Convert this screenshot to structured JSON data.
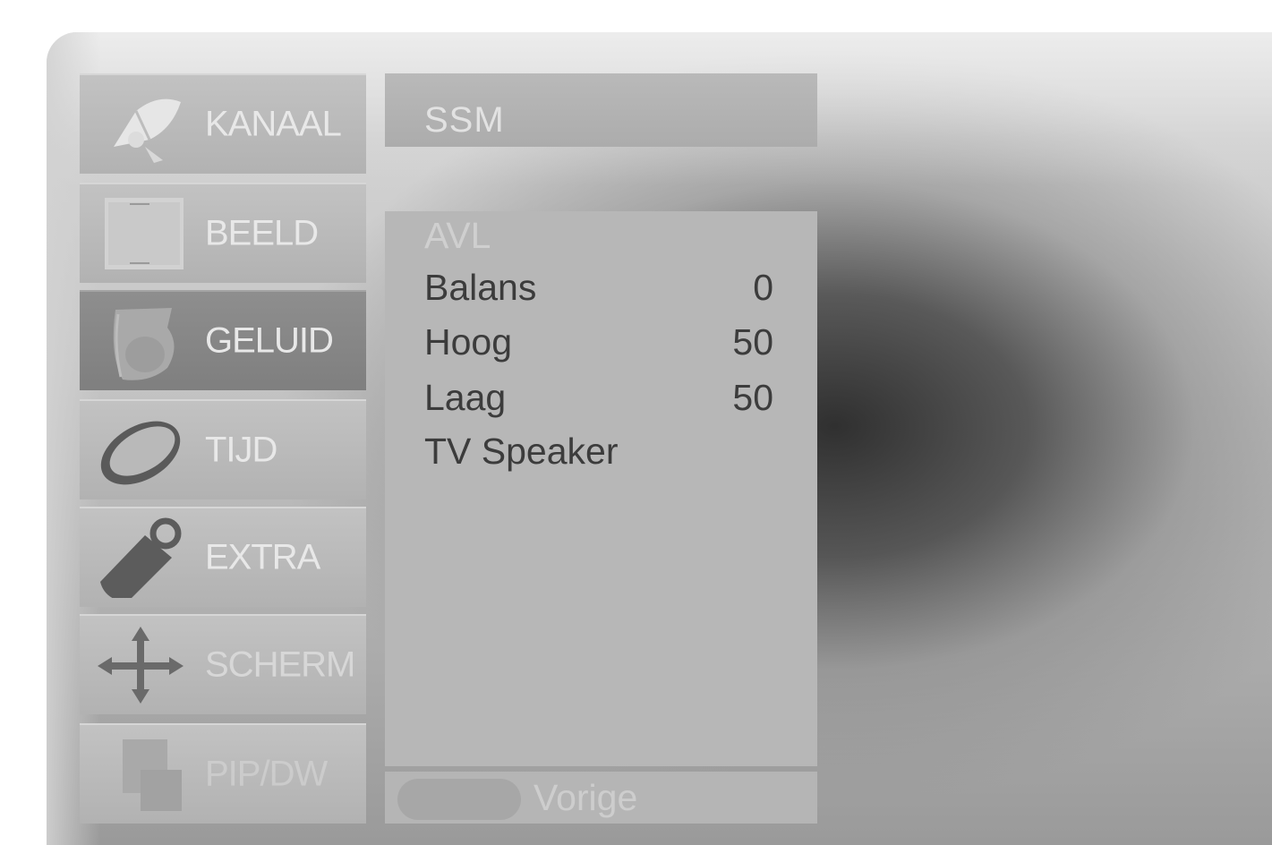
{
  "menu": {
    "items": [
      {
        "label": "KANAAL",
        "icon": "satellite-dish-icon"
      },
      {
        "label": "BEELD",
        "icon": "tv-screen-icon"
      },
      {
        "label": "GELUID",
        "icon": "speaker-icon",
        "selected": true
      },
      {
        "label": "TIJD",
        "icon": "clock-ring-icon"
      },
      {
        "label": "EXTRA",
        "icon": "tag-icon"
      },
      {
        "label": "SCHERM",
        "icon": "move-arrows-icon"
      },
      {
        "label": "PIP/DW",
        "icon": "pip-window-icon"
      }
    ]
  },
  "panel": {
    "title": "SSM",
    "rows": [
      {
        "name": "AVL",
        "value": "",
        "disabled": true
      },
      {
        "name": "Balans",
        "value": "0"
      },
      {
        "name": "Hoog",
        "value": "50"
      },
      {
        "name": "Laag",
        "value": "50"
      },
      {
        "name": "TV Speaker",
        "value": ""
      }
    ],
    "footer_label": "Vorige"
  }
}
